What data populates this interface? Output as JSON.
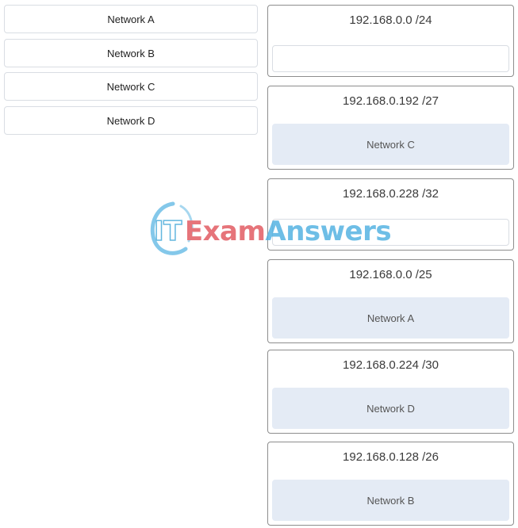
{
  "sources": [
    {
      "label": "Network A"
    },
    {
      "label": "Network B"
    },
    {
      "label": "Network C"
    },
    {
      "label": "Network D"
    }
  ],
  "targets": [
    {
      "address": "192.168.0.0 /24",
      "answer": ""
    },
    {
      "address": "192.168.0.192 /27",
      "answer": "Network C"
    },
    {
      "address": "192.168.0.228 /32",
      "answer": ""
    },
    {
      "address": "192.168.0.0 /25",
      "answer": "Network A"
    },
    {
      "address": "192.168.0.224 /30",
      "answer": "Network D"
    },
    {
      "address": "192.168.0.128 /26",
      "answer": "Network B"
    }
  ],
  "watermark": {
    "it": "IT",
    "exam": "Exam",
    "answers": "Answers"
  },
  "colors": {
    "filled_zone": "#e4ebf5",
    "border": "#8d8d8d",
    "wm_blue": "#4aaee0",
    "wm_red": "#e0525a"
  }
}
